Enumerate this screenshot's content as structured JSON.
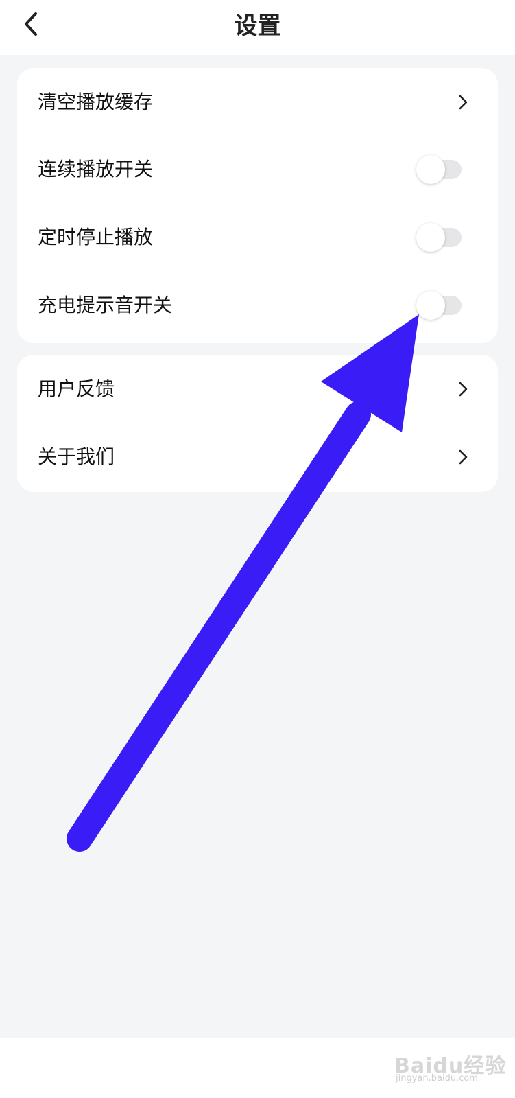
{
  "header": {
    "title": "设置"
  },
  "settings_group": {
    "clear_cache": {
      "label": "清空播放缓存"
    },
    "continuous_play": {
      "label": "连续播放开关",
      "enabled": false
    },
    "timed_stop": {
      "label": "定时停止播放",
      "enabled": false
    },
    "charging_sound": {
      "label": "充电提示音开关",
      "enabled": false
    }
  },
  "info_group": {
    "feedback": {
      "label": "用户反馈"
    },
    "about": {
      "label": "关于我们"
    }
  },
  "annotation": {
    "arrow_color": "#3a1cf7"
  },
  "watermark": {
    "logo": "Baidu经验",
    "url": "jingyan.baidu.com"
  },
  "colors": {
    "background": "#f4f5f7",
    "card": "#ffffff",
    "toggle_off_track": "#e6e6e8"
  }
}
